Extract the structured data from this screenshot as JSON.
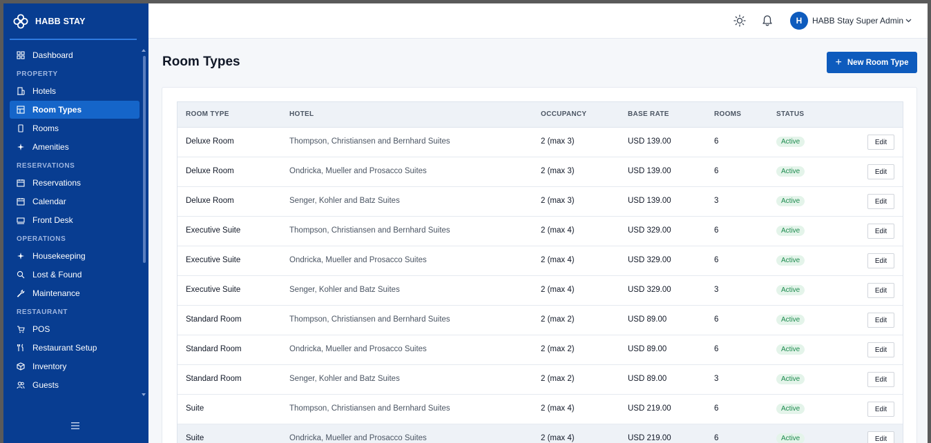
{
  "brand": {
    "name": "HABB STAY"
  },
  "sidebar": {
    "items": [
      {
        "type": "item",
        "label": "Dashboard",
        "icon": "grid-icon"
      },
      {
        "type": "section",
        "label": "PROPERTY"
      },
      {
        "type": "item",
        "label": "Hotels",
        "icon": "building-icon"
      },
      {
        "type": "item",
        "label": "Room Types",
        "icon": "layout-icon",
        "active": true
      },
      {
        "type": "item",
        "label": "Rooms",
        "icon": "door-icon"
      },
      {
        "type": "item",
        "label": "Amenities",
        "icon": "sparkle-icon"
      },
      {
        "type": "section",
        "label": "RESERVATIONS"
      },
      {
        "type": "item",
        "label": "Reservations",
        "icon": "calendar-icon"
      },
      {
        "type": "item",
        "label": "Calendar",
        "icon": "calendar-icon"
      },
      {
        "type": "item",
        "label": "Front Desk",
        "icon": "desk-icon"
      },
      {
        "type": "section",
        "label": "OPERATIONS"
      },
      {
        "type": "item",
        "label": "Housekeeping",
        "icon": "sparkle-icon"
      },
      {
        "type": "item",
        "label": "Lost & Found",
        "icon": "search-icon"
      },
      {
        "type": "item",
        "label": "Maintenance",
        "icon": "wrench-icon"
      },
      {
        "type": "section",
        "label": "RESTAURANT"
      },
      {
        "type": "item",
        "label": "POS",
        "icon": "cart-icon"
      },
      {
        "type": "item",
        "label": "Restaurant Setup",
        "icon": "utensils-icon"
      },
      {
        "type": "item",
        "label": "Inventory",
        "icon": "box-icon"
      },
      {
        "type": "item",
        "label": "Guests",
        "icon": "users-icon"
      }
    ]
  },
  "topbar": {
    "user_initial": "H",
    "user_name": "HABB Stay Super Admin"
  },
  "page": {
    "title": "Room Types",
    "new_button_label": "New Room Type"
  },
  "table": {
    "headers": {
      "room_type": "ROOM TYPE",
      "hotel": "HOTEL",
      "occupancy": "OCCUPANCY",
      "base_rate": "BASE RATE",
      "rooms": "ROOMS",
      "status": "STATUS"
    },
    "edit_label": "Edit",
    "rows": [
      {
        "room_type": "Deluxe Room",
        "hotel": "Thompson, Christiansen and Bernhard Suites",
        "occupancy": "2 (max 3)",
        "base_rate": "USD 139.00",
        "rooms": "6",
        "status": "Active"
      },
      {
        "room_type": "Deluxe Room",
        "hotel": "Ondricka, Mueller and Prosacco Suites",
        "occupancy": "2 (max 3)",
        "base_rate": "USD 139.00",
        "rooms": "6",
        "status": "Active"
      },
      {
        "room_type": "Deluxe Room",
        "hotel": "Senger, Kohler and Batz Suites",
        "occupancy": "2 (max 3)",
        "base_rate": "USD 139.00",
        "rooms": "3",
        "status": "Active"
      },
      {
        "room_type": "Executive Suite",
        "hotel": "Thompson, Christiansen and Bernhard Suites",
        "occupancy": "2 (max 4)",
        "base_rate": "USD 329.00",
        "rooms": "6",
        "status": "Active"
      },
      {
        "room_type": "Executive Suite",
        "hotel": "Ondricka, Mueller and Prosacco Suites",
        "occupancy": "2 (max 4)",
        "base_rate": "USD 329.00",
        "rooms": "6",
        "status": "Active"
      },
      {
        "room_type": "Executive Suite",
        "hotel": "Senger, Kohler and Batz Suites",
        "occupancy": "2 (max 4)",
        "base_rate": "USD 329.00",
        "rooms": "3",
        "status": "Active"
      },
      {
        "room_type": "Standard Room",
        "hotel": "Thompson, Christiansen and Bernhard Suites",
        "occupancy": "2 (max 2)",
        "base_rate": "USD 89.00",
        "rooms": "6",
        "status": "Active"
      },
      {
        "room_type": "Standard Room",
        "hotel": "Ondricka, Mueller and Prosacco Suites",
        "occupancy": "2 (max 2)",
        "base_rate": "USD 89.00",
        "rooms": "6",
        "status": "Active"
      },
      {
        "room_type": "Standard Room",
        "hotel": "Senger, Kohler and Batz Suites",
        "occupancy": "2 (max 2)",
        "base_rate": "USD 89.00",
        "rooms": "3",
        "status": "Active"
      },
      {
        "room_type": "Suite",
        "hotel": "Thompson, Christiansen and Bernhard Suites",
        "occupancy": "2 (max 4)",
        "base_rate": "USD 219.00",
        "rooms": "6",
        "status": "Active"
      },
      {
        "room_type": "Suite",
        "hotel": "Ondricka, Mueller and Prosacco Suites",
        "occupancy": "2 (max 4)",
        "base_rate": "USD 219.00",
        "rooms": "6",
        "status": "Active",
        "hover": true
      }
    ]
  }
}
